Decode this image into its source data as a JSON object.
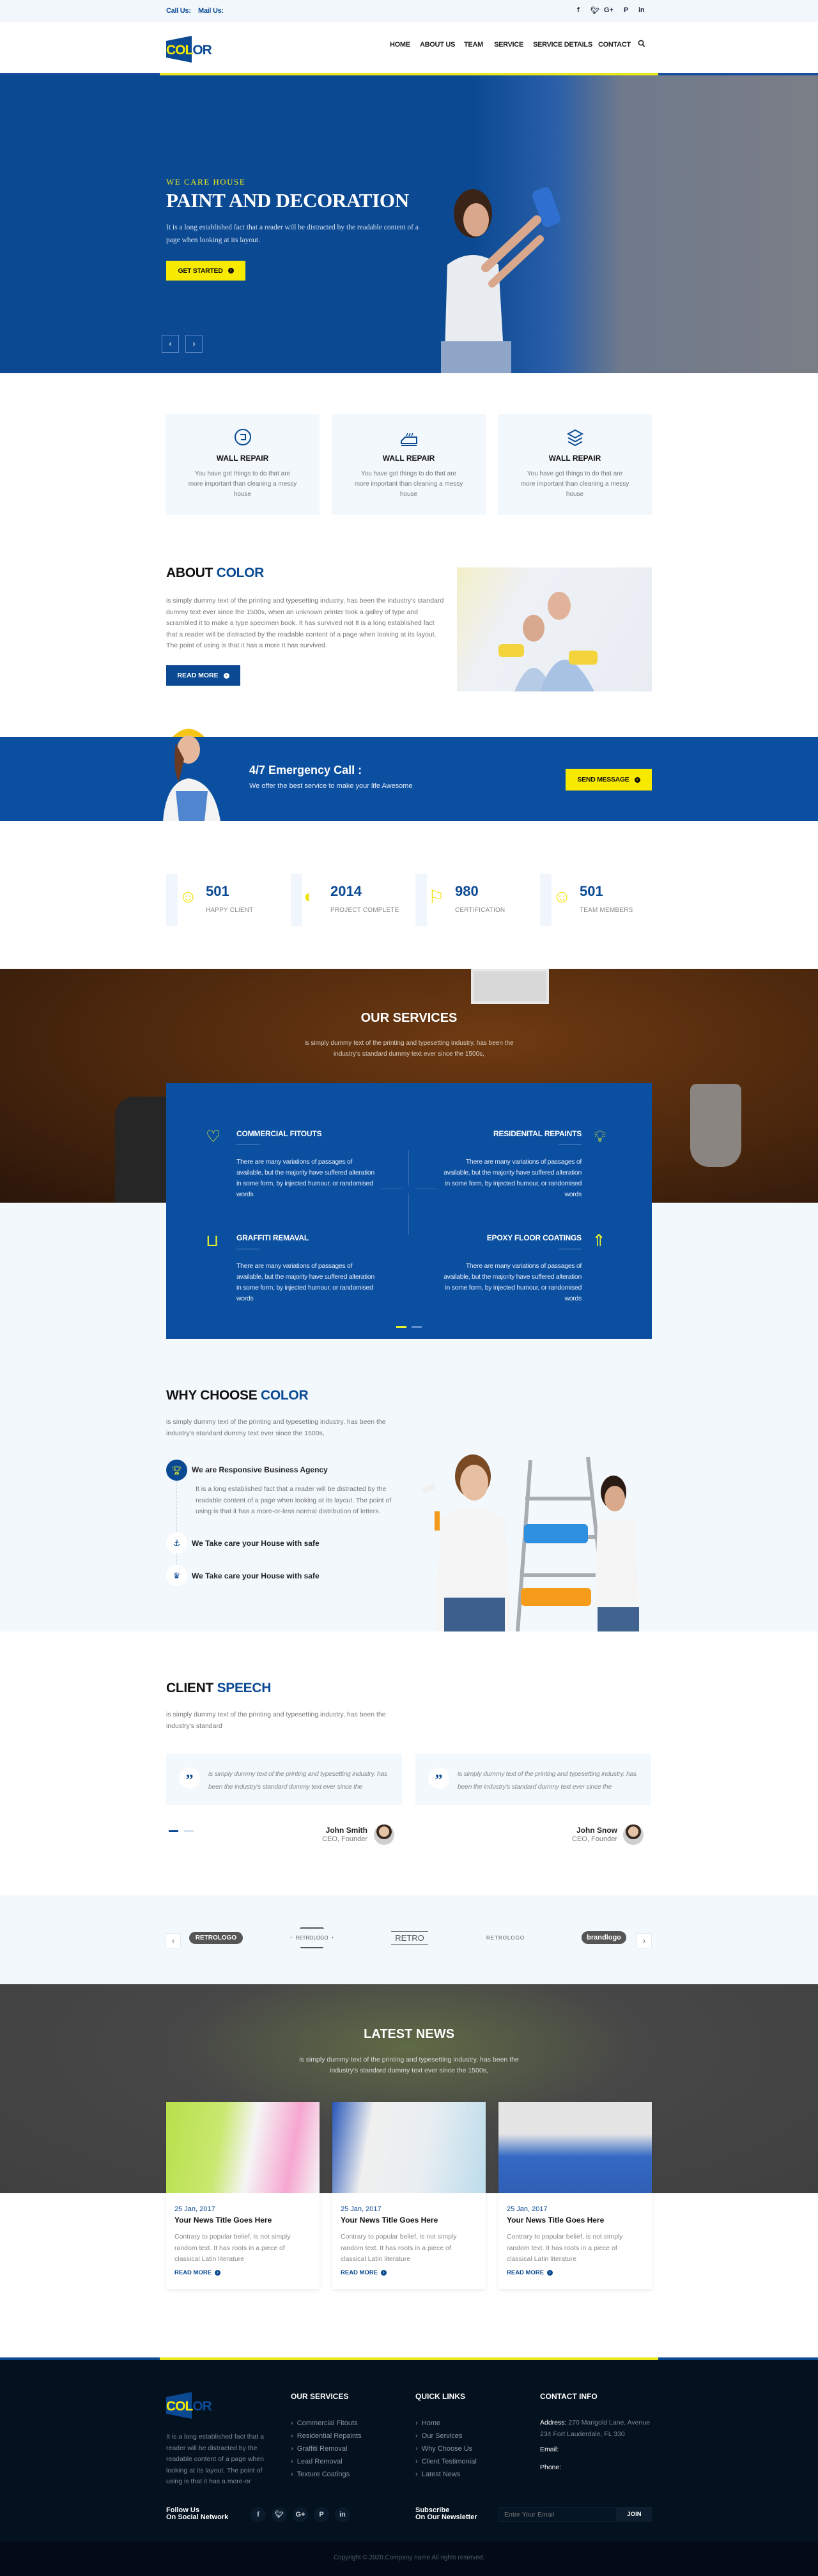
{
  "colors": {
    "primary": "#0b4a93",
    "accent": "#f7ea00",
    "footer": "#04111f",
    "light": "#f3f8fd"
  },
  "topbar": {
    "call_label": "Call Us:",
    "mail_label": "Mail Us:",
    "social": [
      "f",
      "🐦︎",
      "G+",
      "P",
      "in"
    ]
  },
  "brand": {
    "logo_text_yellow": "COL",
    "logo_text_blue": "OR"
  },
  "nav": {
    "items": [
      "HOME",
      "ABOUT US",
      "TEAM",
      "SERVICE",
      "SERVICE DETAILS",
      "CONTACT"
    ],
    "search_icon": "search-icon"
  },
  "hero": {
    "eyebrow": "WE CARE HOUSE",
    "title": "PAINT AND DECORATION",
    "text": "It is a long established fact that a reader will be distracted by the readable content of a page when looking at its layout.",
    "cta": "GET STARTED",
    "prev": "‹",
    "next": "›"
  },
  "features": [
    {
      "icon": "refresh-square-icon",
      "title": "WALL REPAIR",
      "text": "You have got things to do that are more important than cleaning a messy house"
    },
    {
      "icon": "paint-roller-icon",
      "title": "WALL REPAIR",
      "text": "You have got things to do that are more important than cleaning a messy house"
    },
    {
      "icon": "layers-icon",
      "title": "WALL REPAIR",
      "text": "You have got things to do that are more important than cleaning a messy house"
    }
  ],
  "about": {
    "title_a": "ABOUT ",
    "title_b": "COLOR",
    "text": "is simply dummy text of the printing and typesetting industry, has been the industry's standard dummy text ever since the 1500s, when an unknown printer took a galley of type and scrambled it to make a type specimen book. It has survived not It is a long established fact that a reader will be distracted by the readable content of a page when looking at its layout. The point of using is that it has a more It has survived.",
    "cta": "READ MORE"
  },
  "emergency": {
    "title": "4/7 Emergency Call :",
    "subtitle": "We offer the best service to make your life Awesome",
    "cta": "SEND MESSAGE"
  },
  "stats": [
    {
      "value": "501",
      "label": "HAPPY CLIENT"
    },
    {
      "value": "2014",
      "label": "PROJECT COMPLETE"
    },
    {
      "value": "980",
      "label": "CERTIFICATION"
    },
    {
      "value": "501",
      "label": "TEAM MEMBERS"
    }
  ],
  "services": {
    "title": "OUR SERVICES",
    "text": "is simply dummy text of the printing and typesetting industry, has been the industry's standard dummy text ever since the 1500s,",
    "items": [
      {
        "icon": "heart-pulse-icon",
        "title": "COMMERCIAL FITOUTS",
        "text": "There are many variations of passages of available, but the majority have suffered alteration in some form, by injected humour, or randomised words"
      },
      {
        "icon": "lightbulb-icon",
        "title": "RESIDENITAL REPAINTS",
        "text": "There are many variations of passages of available, but the majority have suffered alteration in some form, by injected humour, or randomised words"
      },
      {
        "icon": "basket-icon",
        "title": "GRAFFITI REMAVAL",
        "text": "There are many variations of passages of available, but the majority have suffered alteration in some form, by injected humour, or randomised words"
      },
      {
        "icon": "rocket-icon",
        "title": "EPOXY FLOOR COATINGS",
        "text": "There are many variations of passages of available, but the majority have suffered alteration in some form, by injected humour, or randomised words"
      }
    ],
    "active_slide": 1,
    "slides": 2
  },
  "why": {
    "title_a": "WHY CHOOSE ",
    "title_b": "COLOR",
    "text": "is simply dummy text of the printing and typesetting industry, has been the industry's standard dummy text ever since the 1500s,",
    "items": [
      {
        "icon": "trophy-icon",
        "title": "We are Responsive Business Agency",
        "text": "It is a long established fact that a reader will be distracted by the readable content of a page when looking at its layout. The point of using is that it has a more-or-less normal distribution of letters."
      },
      {
        "icon": "anchor-icon",
        "title": "We Take care your House with safe"
      },
      {
        "icon": "crown-icon",
        "title": "We Take care your House with safe"
      }
    ]
  },
  "testimonials": {
    "title_a": "CLIENT ",
    "title_b": "SPEECH",
    "text": "is simply dummy text of the printing and typesetting industry, has been the industry's standard",
    "items": [
      {
        "quote": "is simply dummy text of the printing and typesetting industry. has been the industry's standard dummy text ever since the",
        "name": "John Smith",
        "role": "CEO, Founder"
      },
      {
        "quote": "is simply dummy text of the printing and typesetting industry. has been the industry's standard dummy text ever since the",
        "name": "John Snow",
        "role": "CEO, Founder"
      }
    ]
  },
  "brands": [
    "RETROLOGO",
    "RETROLOGO",
    "RETRO",
    "RETROLOGO",
    "brandlogo"
  ],
  "news": {
    "title": "LATEST NEWS",
    "text": "is simply dummy text of the printing and typesetting industry. has been the industry's standard dummy text ever since the 1500s,",
    "items": [
      {
        "date": "25 Jan, 2017",
        "title": "Your News Title Goes Here",
        "text": "Contrary to popular belief, is not simply random text. It has roots in a piece of classical Latin literature",
        "cta": "READ MORE"
      },
      {
        "date": "25 Jan, 2017",
        "title": "Your News Title Goes Here",
        "text": "Contrary to popular belief, is not simply random text. It has roots in a piece of classical Latin literature",
        "cta": "READ MORE"
      },
      {
        "date": "25 Jan, 2017",
        "title": "Your News Title Goes Here",
        "text": "Contrary to popular belief, is not simply random text. It has roots in a piece of classical Latin literature",
        "cta": "READ MORE"
      }
    ]
  },
  "footer": {
    "about": "It is a long established fact that a reader will be distracted by the readable content of a page when looking at its layout. The point of using is that it has a more-or",
    "services_title": "OUR SERVICES",
    "services": [
      "Commercial Fitouts",
      "Residential Repaints",
      "Graffiti Removal",
      "Lead Removal",
      "Texture Coatings"
    ],
    "links_title": "QUICK LINKS",
    "links": [
      "Home",
      "Our Services",
      "Why Choose Us",
      "Client Testimonial",
      "Latest News"
    ],
    "contact_title": "CONTACT INFO",
    "address_label": "Address:",
    "address": "270 Marigold Lane, Avenue 234 Fort Lauderdale, FL 330",
    "email_label": "Email:",
    "phone_label": "Phone:",
    "follow_1": "Follow Us",
    "follow_2": "On Social Network",
    "social": [
      "f",
      "🐦︎",
      "G+",
      "P",
      "in"
    ],
    "subscribe_1": "Subscribe",
    "subscribe_2": "On Our Newsletter",
    "email_placeholder": "Enter Your Email",
    "join": "JOIN",
    "copyright": "Copyright © 2020.Company name All rights reserved."
  }
}
